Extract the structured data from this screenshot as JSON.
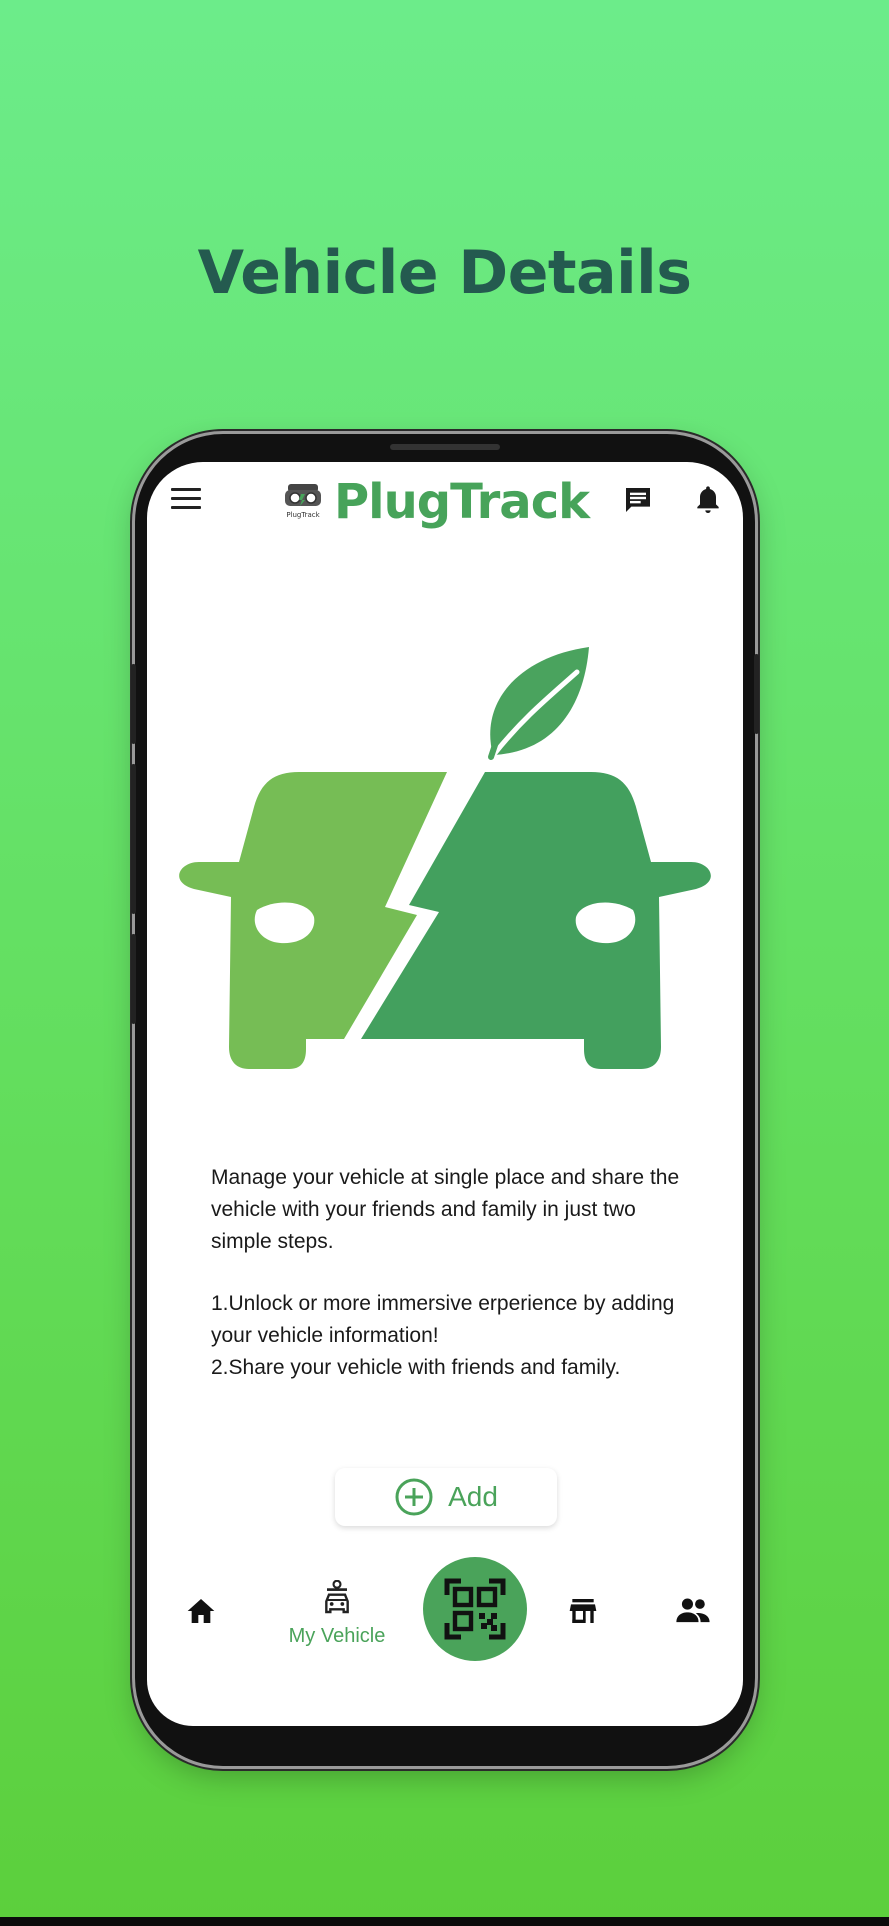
{
  "headline": "Vehicle Details",
  "app": {
    "brand_name": "PlugTrack",
    "brand_logo_text": "PlugTrack"
  },
  "topbar": {
    "menu_icon": "hamburger-menu-icon",
    "chat_icon": "chat-icon",
    "bell_icon": "bell-icon"
  },
  "hero": {
    "icon": "ev-car-leaf-lightning-icon"
  },
  "description": {
    "intro": "Manage your vehicle at single place and share the vehicle with your friends and family in just two simple steps.",
    "step1": "1.Unlock or more immersive erperience by adding your vehicle information!",
    "step2": "2.Share your vehicle with friends and family."
  },
  "add_button": {
    "label": "Add",
    "icon": "plus-circle-icon"
  },
  "bottom_nav": {
    "home_icon": "home-icon",
    "my_vehicle_label": "My Vehicle",
    "my_vehicle_icon": "car-key-icon",
    "qr_icon": "qr-code-icon",
    "store_icon": "store-icon",
    "people_icon": "people-icon",
    "active_item": "My Vehicle"
  },
  "colors": {
    "background_top": "#6cec8a",
    "background_bottom": "#5ccf3c",
    "headline": "#245a4f",
    "brand_green": "#47a35a",
    "hero_light_green": "#75bd55",
    "hero_dark_green": "#43a05e"
  }
}
